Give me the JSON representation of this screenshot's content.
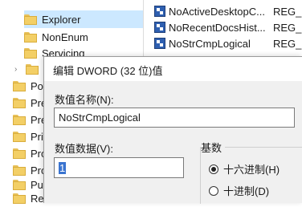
{
  "tree": {
    "items": [
      {
        "label": "Explorer"
      },
      {
        "label": "NonEnum"
      },
      {
        "label": "Servicing"
      },
      {
        "label": "S"
      },
      {
        "label": "Pow"
      },
      {
        "label": "Pre"
      },
      {
        "label": "Pre"
      },
      {
        "label": "Priv"
      },
      {
        "label": "Pro"
      },
      {
        "label": "Pro"
      },
      {
        "label": "Pus"
      },
      {
        "label": "Reli"
      }
    ]
  },
  "values": {
    "rows": [
      {
        "name": "NoActiveDesktopC...",
        "type": "REG_"
      },
      {
        "name": "NoRecentDocsHist...",
        "type": "REG_"
      },
      {
        "name": "NoStrCmpLogical",
        "type": "REG_"
      }
    ]
  },
  "dialog": {
    "title": "编辑 DWORD (32 位)值",
    "name_label": "数值名称(N):",
    "name_value": "NoStrCmpLogical",
    "data_label": "数值数据(V):",
    "data_value": "1",
    "base_label": "基数",
    "radio_hex": "十六进制(H)",
    "radio_dec": "十进制(D)"
  },
  "colors": {
    "selection": "#cce8ff",
    "folder": "#f3cf66",
    "highlight": "#3a74d0"
  }
}
